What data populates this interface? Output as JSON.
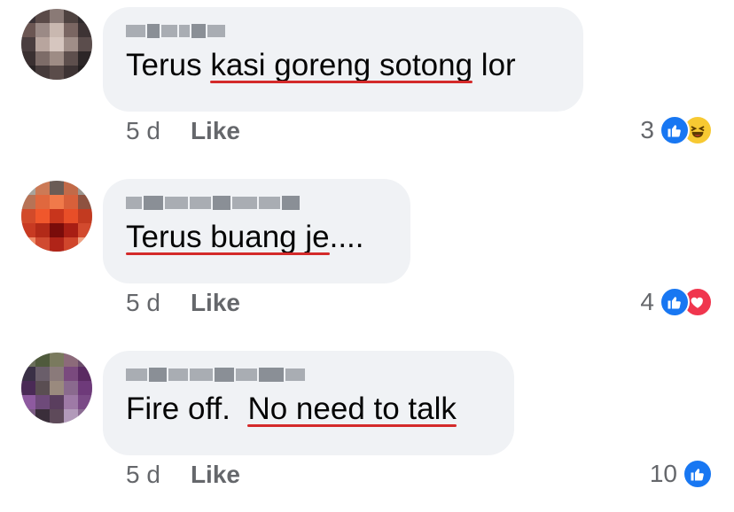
{
  "comments": [
    {
      "text_plain": "Terus ",
      "text_underlined": "kasi goreng sotong",
      "text_after": " lor",
      "time": "5 d",
      "like_label": "Like",
      "reaction_count": "3",
      "reactions": [
        "like-icon",
        "haha-icon"
      ]
    },
    {
      "text_plain": "",
      "text_underlined": "Terus buang je",
      "text_after": "....",
      "time": "5 d",
      "like_label": "Like",
      "reaction_count": "4",
      "reactions": [
        "like-icon",
        "love-icon"
      ]
    },
    {
      "text_plain": "Fire off.  ",
      "text_underlined": "No need to talk",
      "text_after": "",
      "time": "5 d",
      "like_label": "Like",
      "reaction_count": "10",
      "reactions": [
        "like-icon"
      ]
    }
  ],
  "colors": {
    "bubble": "#f0f2f5",
    "underline": "#d42a2a",
    "like_blue": "#1877f2",
    "love_red": "#f0364e",
    "haha_yellow": "#f7c932"
  }
}
